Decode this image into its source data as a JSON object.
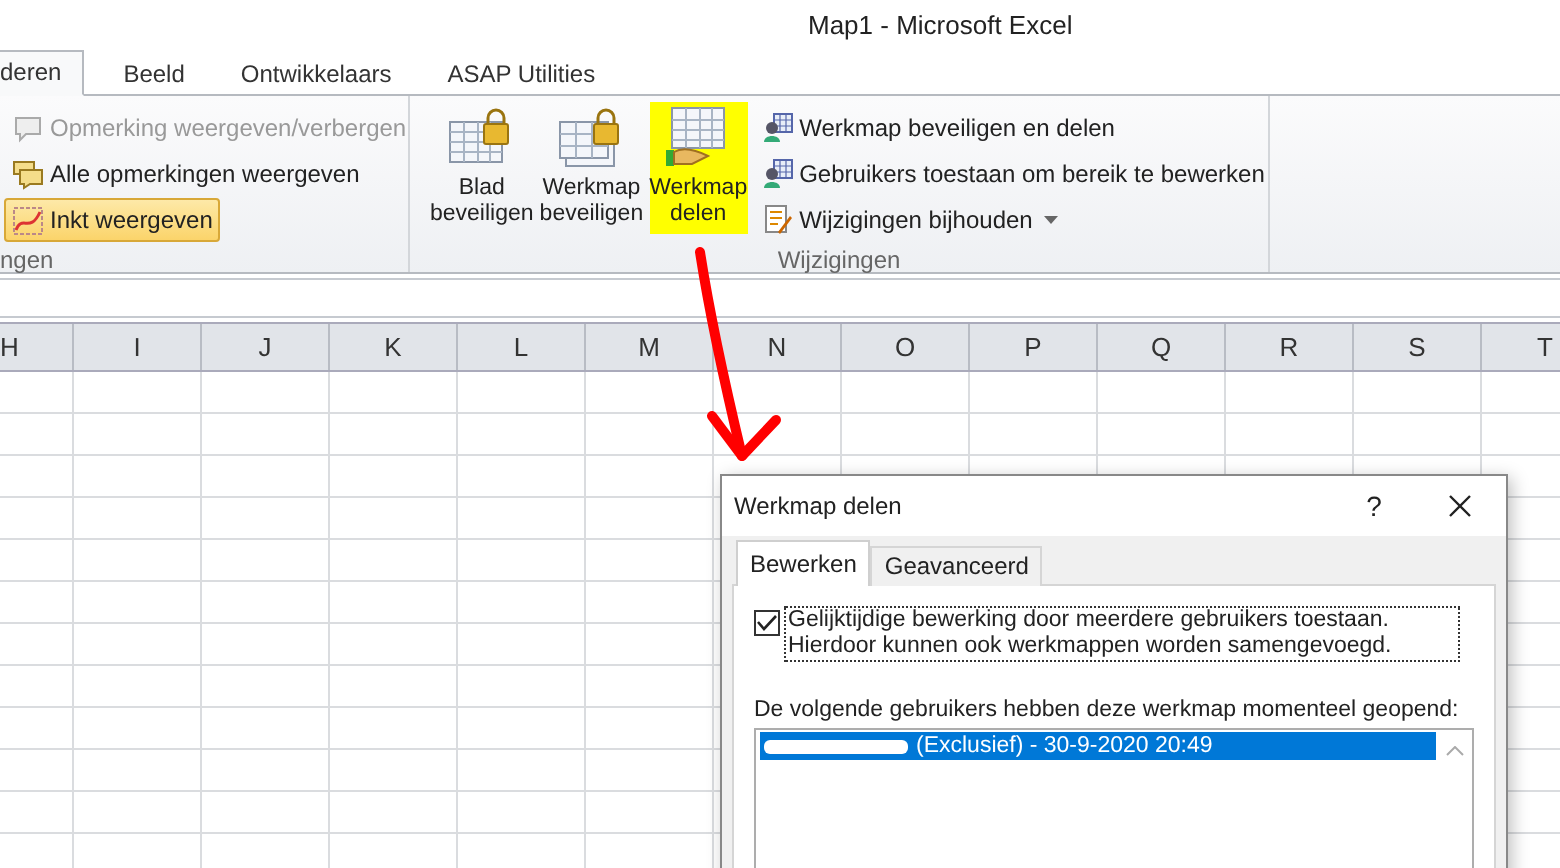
{
  "window": {
    "title": "Map1 - Microsoft Excel"
  },
  "ribbon_tabs": [
    {
      "label": "deren",
      "selected": true
    },
    {
      "label": "Beeld",
      "selected": false
    },
    {
      "label": "Ontwikkelaars",
      "selected": false
    },
    {
      "label": "ASAP Utilities",
      "selected": false
    }
  ],
  "comments_group": {
    "label": "ngen",
    "items": [
      {
        "label": "Opmerking weergeven/verbergen",
        "disabled": true,
        "selected": false
      },
      {
        "label": "Alle opmerkingen weergeven",
        "disabled": false,
        "selected": false
      },
      {
        "label": "Inkt weergeven",
        "disabled": false,
        "selected": true
      }
    ]
  },
  "changes_group": {
    "label": "Wijzigingen",
    "large_buttons": [
      {
        "label": "Blad\nbeveiligen",
        "highlighted": false
      },
      {
        "label": "Werkmap\nbeveiligen",
        "highlighted": false
      },
      {
        "label": "Werkmap\ndelen",
        "highlighted": true
      }
    ],
    "small_buttons": [
      {
        "label": "Werkmap beveiligen en delen",
        "dropdown": false
      },
      {
        "label": "Gebruikers toestaan om bereik te bewerken",
        "dropdown": false
      },
      {
        "label": "Wijzigingen bijhouden",
        "dropdown": true
      }
    ]
  },
  "columns": [
    "H",
    "I",
    "J",
    "K",
    "L",
    "M",
    "N",
    "O",
    "P",
    "Q",
    "R",
    "S",
    "T"
  ],
  "dialog": {
    "title": "Werkmap delen",
    "help_button": "?",
    "tabs": [
      {
        "label": "Bewerken",
        "selected": true
      },
      {
        "label": "Geavanceerd",
        "selected": false
      }
    ],
    "checkbox": {
      "label": "Gelijktijdige bewerking door meerdere gebruikers toestaan. Hierdoor kunnen ook werkmappen worden samengevoegd.",
      "checked": true
    },
    "list_label": "De volgende gebruikers hebben deze werkmap momenteel geopend:",
    "users": [
      {
        "text": "(Exclusief) - 30-9-2020 20:49",
        "selected": true,
        "name_redacted": true
      }
    ]
  }
}
